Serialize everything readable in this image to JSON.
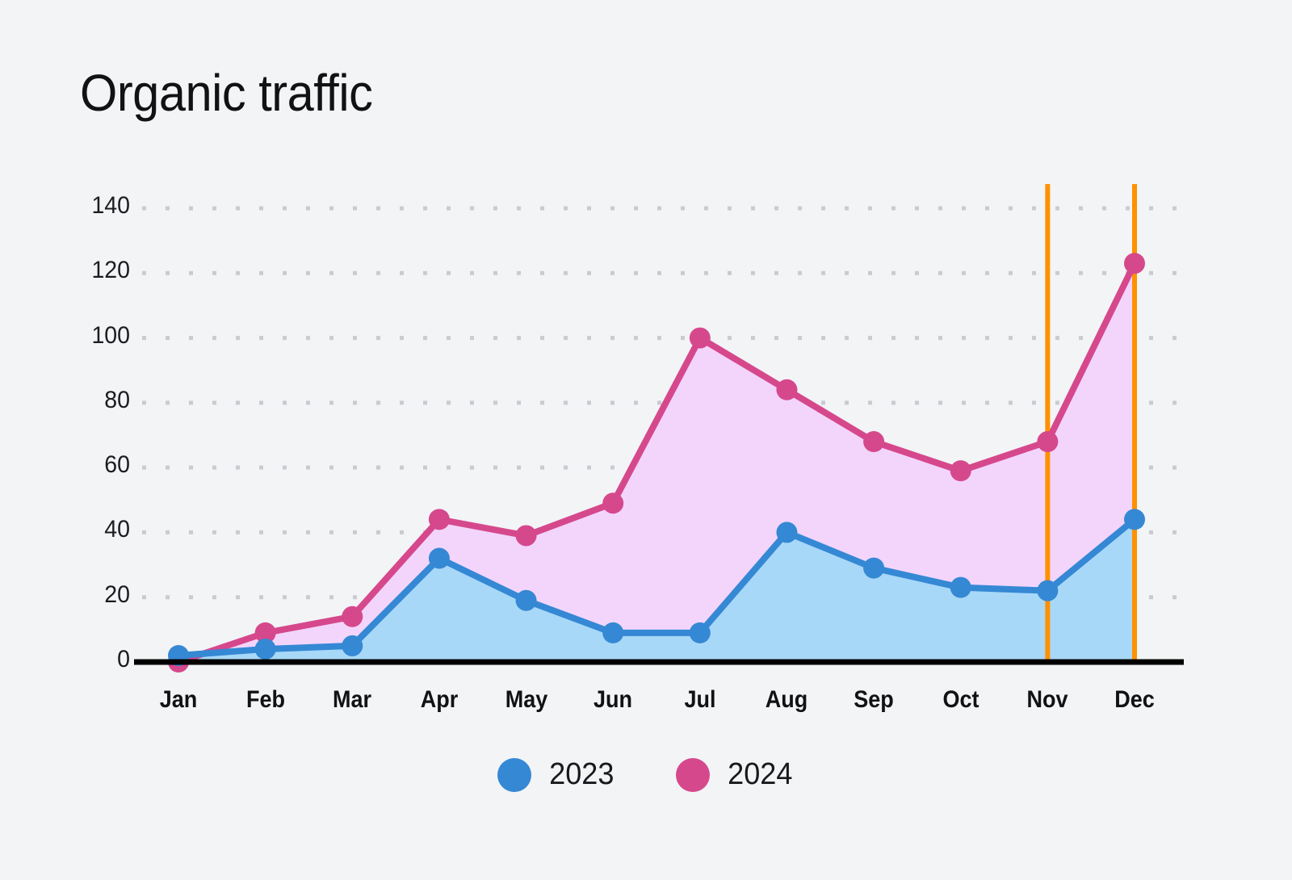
{
  "chart_data": {
    "type": "area",
    "title": "Organic traffic",
    "xlabel": "",
    "ylabel": "",
    "categories": [
      "Jan",
      "Feb",
      "Mar",
      "Apr",
      "May",
      "Jun",
      "Jul",
      "Aug",
      "Sep",
      "Oct",
      "Nov",
      "Dec"
    ],
    "series": [
      {
        "name": "2023",
        "color": "#3588d4",
        "fill": "#a8d8f8",
        "values": [
          2,
          4,
          5,
          32,
          19,
          9,
          9,
          40,
          29,
          23,
          22,
          44
        ]
      },
      {
        "name": "2024",
        "color": "#d6488c",
        "fill": "#f3d5fc",
        "values": [
          0,
          9,
          14,
          44,
          39,
          49,
          100,
          84,
          68,
          59,
          68,
          123
        ]
      }
    ],
    "ylim": [
      0,
      140
    ],
    "yticks": [
      0,
      20,
      40,
      60,
      80,
      100,
      120,
      140
    ],
    "ytick_labels": [
      "0",
      "20",
      "40",
      "60",
      "80",
      "100",
      "120",
      "140"
    ],
    "grid": "horizontal-dotted",
    "grid_color": "#c9cbd0",
    "axis_color": "#000000",
    "background": "#f2f4f6",
    "legend_position": "bottom-center",
    "annotations": [
      {
        "type": "vertical-line",
        "at": "Nov",
        "color": "#ff9100"
      },
      {
        "type": "vertical-line",
        "at": "Dec",
        "color": "#ff9100"
      }
    ]
  },
  "legend": {
    "items": [
      {
        "label": "2023",
        "color": "#3588d4"
      },
      {
        "label": "2024",
        "color": "#d6488c"
      }
    ]
  }
}
